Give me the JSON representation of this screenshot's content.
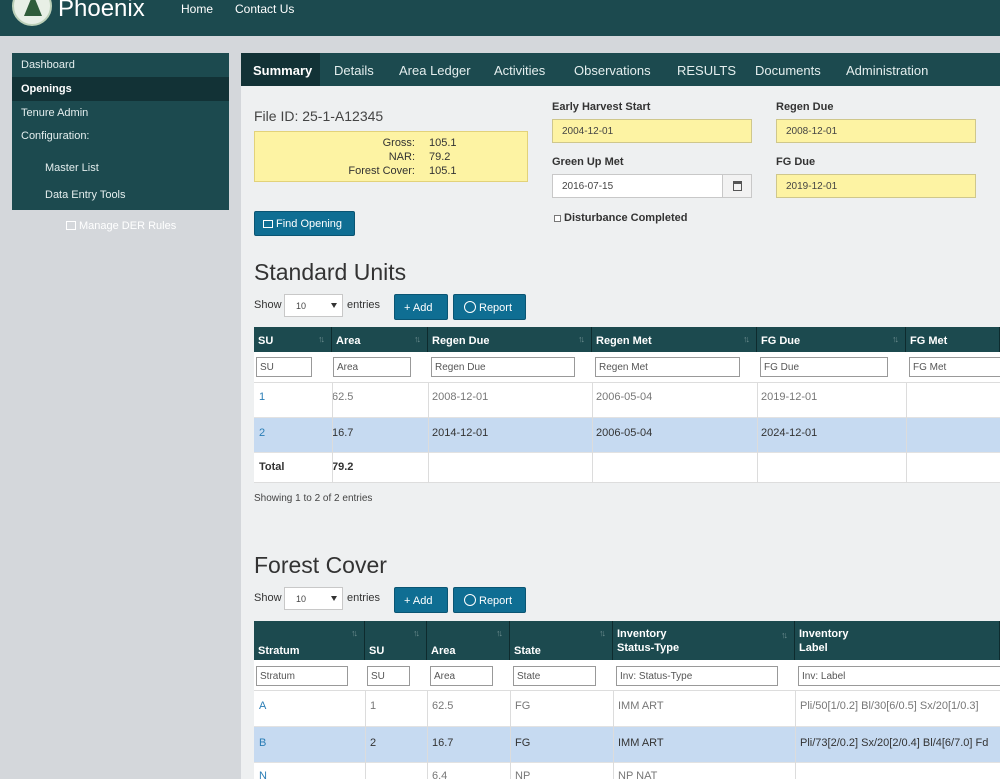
{
  "brand": "Phoenix",
  "topnav": [
    "Home",
    "Contact Us"
  ],
  "sidebar": {
    "items": [
      {
        "label": "Dashboard"
      },
      {
        "label": "Openings"
      },
      {
        "label": "Tenure Admin"
      },
      {
        "label": "Configuration:"
      },
      {
        "label": "Master List"
      },
      {
        "label": "Data Entry Tools"
      }
    ],
    "der_link": "Manage DER Rules"
  },
  "tabs": [
    "Summary",
    "Details",
    "Area Ledger",
    "Activities",
    "Observations",
    "RESULTS",
    "Documents",
    "Administration"
  ],
  "summary": {
    "file_id": "File ID: 25-1-A12345",
    "gross_label": "Gross:",
    "gross": "105.1",
    "nar_label": "NAR:",
    "nar": "79.2",
    "fc_label": "Forest Cover:",
    "fc": "105.1",
    "find_button": "Find Opening",
    "early_harvest_label": "Early Harvest Start",
    "early_harvest": "2004-12-01",
    "regen_due_label": "Regen Due",
    "regen_due": "2008-12-01",
    "green_up_label": "Green Up Met",
    "green_up": "2016-07-15",
    "fg_due_label": "FG Due",
    "fg_due": "2019-12-01",
    "disturbance_label": "Disturbance Completed"
  },
  "standard_units": {
    "title": "Standard Units",
    "show": "Show",
    "entries_value": "10",
    "entries": "entries",
    "add": "Add",
    "report": "Report",
    "headers": [
      "SU",
      "Area",
      "Regen Due",
      "Regen Met",
      "FG Due",
      "FG Met"
    ],
    "filters": [
      "SU",
      "Area",
      "Regen Due",
      "Regen Met",
      "FG Due",
      "FG Met"
    ],
    "rows": [
      [
        "1",
        "62.5",
        "2008-12-01",
        "2006-05-04",
        "2019-12-01",
        ""
      ],
      [
        "2",
        "16.7",
        "2014-12-01",
        "2006-05-04",
        "2024-12-01",
        ""
      ]
    ],
    "total_label": "Total",
    "total_area": "79.2",
    "info": "Showing 1 to 2 of 2 entries"
  },
  "forest_cover": {
    "title": "Forest Cover",
    "show": "Show",
    "entries_value": "10",
    "entries": "entries",
    "add": "Add",
    "report": "Report",
    "headers": [
      "Stratum",
      "SU",
      "Area",
      "State",
      "Inventory\nStatus-Type",
      "Inventory\nLabel"
    ],
    "filters": [
      "Stratum",
      "SU",
      "Area",
      "State",
      "Inv: Status-Type",
      "Inv: Label"
    ],
    "rows": [
      [
        "A",
        "1",
        "62.5",
        "FG",
        "IMM ART",
        "Pli/50[1/0.2] Bl/30[6/0.5] Sx/20[1/0.3]"
      ],
      [
        "B",
        "2",
        "16.7",
        "FG",
        "IMM ART",
        "Pli/73[2/0.2] Sx/20[2/0.4] Bl/4[6/7.0] Fd"
      ],
      [
        "N",
        "",
        "6.4",
        "NP",
        "NP NAT",
        ""
      ]
    ]
  }
}
